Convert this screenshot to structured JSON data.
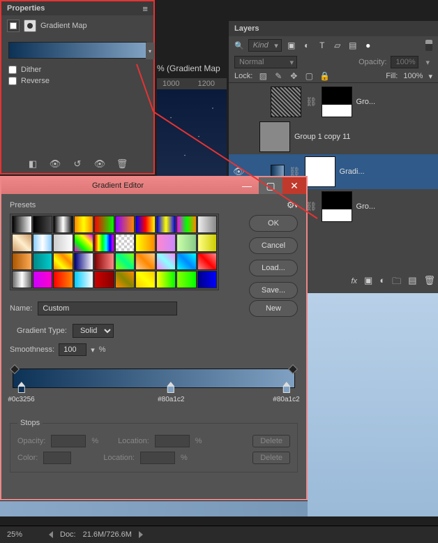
{
  "canvas": {
    "docTab": "% (Gradient Map",
    "rulerTicks": [
      "1000",
      "1200"
    ]
  },
  "statusBar": {
    "zoom": "25%",
    "docLabel": "Doc:",
    "docSize": "21.6M/726.6M"
  },
  "properties": {
    "title": "Properties",
    "adjLabel": "Gradient Map",
    "dither": "Dither",
    "reverse": "Reverse"
  },
  "layers": {
    "title": "Layers",
    "kindPlaceholder": "Kind",
    "blendMode": "Normal",
    "opacityLabel": "Opacity:",
    "opacityValue": "100%",
    "lockLabel": "Lock:",
    "fillLabel": "Fill:",
    "fillValue": "100%",
    "items": [
      {
        "name": "Gro..."
      },
      {
        "name": "Group 1 copy 11"
      },
      {
        "name": "Gradi..."
      },
      {
        "name": "Gro..."
      }
    ]
  },
  "gradientEditor": {
    "title": "Gradient Editor",
    "presetsLabel": "Presets",
    "buttons": {
      "ok": "OK",
      "cancel": "Cancel",
      "load": "Load...",
      "save": "Save...",
      "new": "New"
    },
    "nameLabel": "Name:",
    "nameValue": "Custom",
    "gradientTypeLabel": "Gradient Type:",
    "gradientTypeValue": "Solid",
    "smoothnessLabel": "Smoothness:",
    "smoothnessValue": "100",
    "smoothnessUnit": "%",
    "stops": [
      {
        "color": "#0c3256",
        "pos": 0
      },
      {
        "color": "#80a1c2",
        "pos": 50
      },
      {
        "color": "#80a1c2",
        "pos": 100
      }
    ],
    "stopsLegend": "Stops",
    "opacityLabel": "Opacity:",
    "opacityUnit": "%",
    "locationLabel": "Location:",
    "locationUnit": "%",
    "colorLabel": "Color:",
    "deleteLabel": "Delete"
  },
  "presetSwatches": [
    "linear-gradient(90deg,#000,#fff)",
    "linear-gradient(90deg,#000,transparent)",
    "linear-gradient(90deg,#000,#fff,#000)",
    "linear-gradient(90deg,#f80,#ff0,#f80)",
    "linear-gradient(90deg,#f00,#0f0)",
    "linear-gradient(90deg,#80f,#f80)",
    "linear-gradient(90deg,#00f,#f00,#ff0)",
    "linear-gradient(90deg,#00f,#ff0,#00f)",
    "linear-gradient(90deg,#f0f,#0f0,#f80)",
    "linear-gradient(90deg,#eee,#888)",
    "linear-gradient(45deg,#c96,#fec,#c96)",
    "linear-gradient(90deg,#8cf,#fff,#8cf)",
    "linear-gradient(90deg,#ccc,#fff)",
    "linear-gradient(45deg,#f0f,#0f0,#ff0,#f0f)",
    "linear-gradient(90deg,#f00,#ff0,#0f0,#0ff,#00f,#f0f)",
    "repeating-conic-gradient(#ccc 0 25%,#fff 0 50%) 0/8px 8px",
    "linear-gradient(90deg,#ff0,#f80)",
    "linear-gradient(90deg,#f8c,#c8f)",
    "linear-gradient(90deg,#cfa,#8c8)",
    "linear-gradient(90deg,#ff8,#cc0)",
    "linear-gradient(90deg,#a50,#fa5)",
    "linear-gradient(90deg,#088,#0cc)",
    "linear-gradient(45deg,#f80,#ff0,#f80,#ff0)",
    "linear-gradient(90deg,#000080,#fff)",
    "linear-gradient(90deg,#800,#f88)",
    "linear-gradient(45deg,#8f0,#0f8,#8f0)",
    "linear-gradient(45deg,#fc8,#f80,#fc8)",
    "linear-gradient(45deg,#f8f,#8ff,#f8f)",
    "linear-gradient(45deg,#0ff,#08f,#0ff)",
    "linear-gradient(45deg,#f88,#f00,#f88)",
    "linear-gradient(90deg,#666,#fff,#666)",
    "linear-gradient(90deg,#c0f,#f0c)",
    "linear-gradient(90deg,#f00,#f80)",
    "linear-gradient(90deg,#0cf,#fff)",
    "linear-gradient(90deg,#c00,#800)",
    "linear-gradient(45deg,#f80,#880,#f80)",
    "linear-gradient(45deg,#fc0,#ff0,#fc0)",
    "linear-gradient(90deg,#ff0,#0f0)",
    "linear-gradient(90deg,#8f0,#0f0)",
    "linear-gradient(90deg,#008,#00f)"
  ]
}
